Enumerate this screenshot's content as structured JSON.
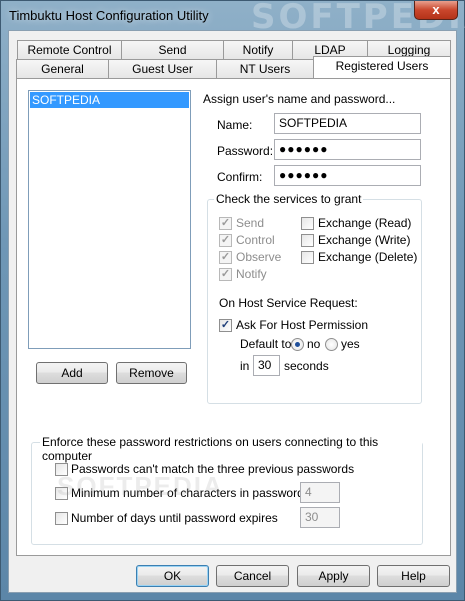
{
  "window": {
    "title": "Timbuktu Host Configuration Utility",
    "watermark": "SOFTPEDIA",
    "close_glyph": "x"
  },
  "tabs_row1": [
    "Remote Control",
    "Send",
    "Notify",
    "LDAP",
    "Logging"
  ],
  "tabs_row2": [
    "General",
    "Guest User",
    "NT Users",
    "Registered Users"
  ],
  "active_tab": "Registered Users",
  "users": {
    "items": [
      "SOFTPEDIA"
    ],
    "add_label": "Add",
    "remove_label": "Remove"
  },
  "assign": {
    "heading": "Assign user's name and password...",
    "name_label": "Name:",
    "name_value": "SOFTPEDIA",
    "password_label": "Password:",
    "password_value": "●●●●●●",
    "confirm_label": "Confirm:",
    "confirm_value": "●●●●●●"
  },
  "services": {
    "title": "Check the services to grant",
    "left": [
      {
        "label": "Send",
        "checked": true
      },
      {
        "label": "Control",
        "checked": true
      },
      {
        "label": "Observe",
        "checked": true
      },
      {
        "label": "Notify",
        "checked": true
      }
    ],
    "right": [
      {
        "label": "Exchange (Read)",
        "checked": false
      },
      {
        "label": "Exchange (Write)",
        "checked": false
      },
      {
        "label": "Exchange (Delete)",
        "checked": false
      }
    ]
  },
  "host_request": {
    "title": "On Host Service Request:",
    "ask_label": "Ask For Host Permission",
    "ask_checked": true,
    "default_label": "Default to",
    "no_label": "no",
    "yes_label": "yes",
    "selected": "no",
    "in_label": "in",
    "seconds_value": "30",
    "seconds_label": "seconds"
  },
  "restrictions": {
    "title": "Enforce these password restrictions on users connecting to this computer",
    "items": [
      {
        "label": "Passwords can't match the three previous passwords",
        "checked": false
      },
      {
        "label": "Minimum number of characters in passwords",
        "checked": false,
        "value": "4"
      },
      {
        "label": "Number of days until password expires",
        "checked": false,
        "value": "30"
      }
    ]
  },
  "footer": {
    "ok": "OK",
    "cancel": "Cancel",
    "apply": "Apply",
    "help": "Help"
  }
}
